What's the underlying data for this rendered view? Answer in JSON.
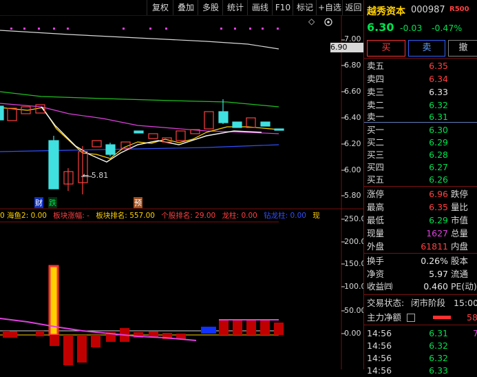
{
  "toolbar": {
    "buttons": [
      "复权",
      "叠加",
      "多股",
      "统计",
      "画线",
      "F10",
      "标记",
      "+自选",
      "返回"
    ]
  },
  "chart": {
    "y_axis": [
      "7.00",
      "6.90",
      "6.80",
      "6.60",
      "6.40",
      "6.20",
      "6.00",
      "5.80"
    ],
    "current_price_tag": "6.90",
    "low_label": "5.81",
    "markers": [
      "财",
      "跌",
      "预"
    ],
    "diamond_icon": "◇",
    "indicator_bar": [
      {
        "text": "0 海鱼2: 0.00",
        "color": "#ffd000"
      },
      {
        "text": "板块涨幅: -",
        "color": "#ff4040"
      },
      {
        "text": "板块排名: 557.00",
        "color": "#ffd000"
      },
      {
        "text": "个股排名: 29.00",
        "color": "#ff4040"
      },
      {
        "text": "龙柱: 0.00",
        "color": "#ff4040"
      },
      {
        "text": "钻龙柱: 0.00",
        "color": "#3050ff"
      },
      {
        "text": "现",
        "color": "#ffd000"
      }
    ],
    "volume_axis": [
      "250.00",
      "200.00",
      "150.00",
      "100.00",
      "50.00",
      "0.00"
    ]
  },
  "stock": {
    "name": "越秀资本",
    "code": "000987",
    "badge": "R500",
    "price": "6.30",
    "change": "-0.03",
    "change_pct": "-0.47%",
    "buttons": [
      "买",
      "卖",
      "撤"
    ]
  },
  "order_book": {
    "asks": [
      {
        "label": "卖五",
        "price": "6.35",
        "color": "red"
      },
      {
        "label": "卖四",
        "price": "6.34",
        "color": "red"
      },
      {
        "label": "卖三",
        "price": "6.33",
        "color": "white"
      },
      {
        "label": "卖二",
        "price": "6.32",
        "color": "green"
      },
      {
        "label": "卖一",
        "price": "6.31",
        "color": "green"
      }
    ],
    "bids": [
      {
        "label": "买一",
        "price": "6.30",
        "color": "green"
      },
      {
        "label": "买二",
        "price": "6.29",
        "color": "green"
      },
      {
        "label": "买三",
        "price": "6.28",
        "color": "green"
      },
      {
        "label": "买四",
        "price": "6.27",
        "color": "green"
      },
      {
        "label": "买五",
        "price": "6.26",
        "color": "green"
      }
    ]
  },
  "stats": [
    {
      "l1": "涨停",
      "v1": "6.96",
      "c1": "red",
      "l2": "跌停"
    },
    {
      "l1": "最高",
      "v1": "6.35",
      "c1": "red",
      "l2": "量比"
    },
    {
      "l1": "最低",
      "v1": "6.29",
      "c1": "green",
      "l2": "市值"
    },
    {
      "l1": "现量",
      "v1": "1627",
      "c1": "purple",
      "l2": "总量"
    },
    {
      "l1": "外盘",
      "v1": "61811",
      "c1": "red",
      "l2": "内盘"
    }
  ],
  "stats2": [
    {
      "l1": "换手",
      "v1": "0.26%",
      "l2": "股本"
    },
    {
      "l1": "净资",
      "v1": "5.97",
      "l2": "流通"
    },
    {
      "l1": "收益㈣",
      "v1": "0.460",
      "l2": "PE(动)"
    }
  ],
  "trade_status": {
    "label": "交易状态:",
    "value": "闭市阶段",
    "time": "15:00:"
  },
  "net_flow": {
    "label": "主力净额",
    "value": "58"
  },
  "ticks": [
    {
      "time": "14:56",
      "price": "6.31",
      "extra": "7"
    },
    {
      "time": "14:56",
      "price": "6.32",
      "extra": ""
    },
    {
      "time": "14:56",
      "price": "6.32",
      "extra": ""
    },
    {
      "time": "14:56",
      "price": "6.33",
      "extra": ""
    }
  ]
}
